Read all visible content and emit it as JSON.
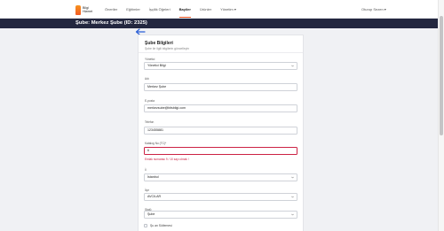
{
  "brand": {
    "name": "Bilgi\nHizmet",
    "accent": "#f15a24"
  },
  "nav": {
    "items": [
      {
        "label": "Öneriler"
      },
      {
        "label": "Eğitimler"
      },
      {
        "label": "İşçilik Öğeleri"
      },
      {
        "label": "Bayiler"
      },
      {
        "label": "Ürünler"
      },
      {
        "label": "Yönetim ▾"
      }
    ],
    "active_index": 3
  },
  "user": {
    "label": "Oturup Sezen ▾"
  },
  "header": {
    "title": "Şube: Merkez Şube (ID: 2325)"
  },
  "form": {
    "title": "Şube Bilgileri",
    "subtitle": "Şube ile ilgili bilgilerin güncelleyin",
    "fields": [
      {
        "label": "Yönetici",
        "value": "Yönetici Bilgi"
      },
      {
        "label": "Adı",
        "value": "Merkez Şube"
      },
      {
        "label": "E-posta",
        "value": "merkezsube@bitsbilgi.com"
      },
      {
        "label": "Telefon",
        "value": "123455881"
      },
      {
        "label": "Katalog No (TC)*",
        "value": "6",
        "error": "Emlak numarası 9 / 10 sayı olmalı !"
      },
      {
        "label": "İl",
        "value": "İstanbul"
      },
      {
        "label": "İlçe",
        "value": "AVCILAR"
      },
      {
        "label": "Statü",
        "value": "Şube"
      }
    ],
    "checkbox_label": "Şu an Sütlemesi"
  },
  "colors": {
    "header_bg": "#23273f",
    "error": "#cc2244",
    "link_blue": "#2b5fd6"
  }
}
